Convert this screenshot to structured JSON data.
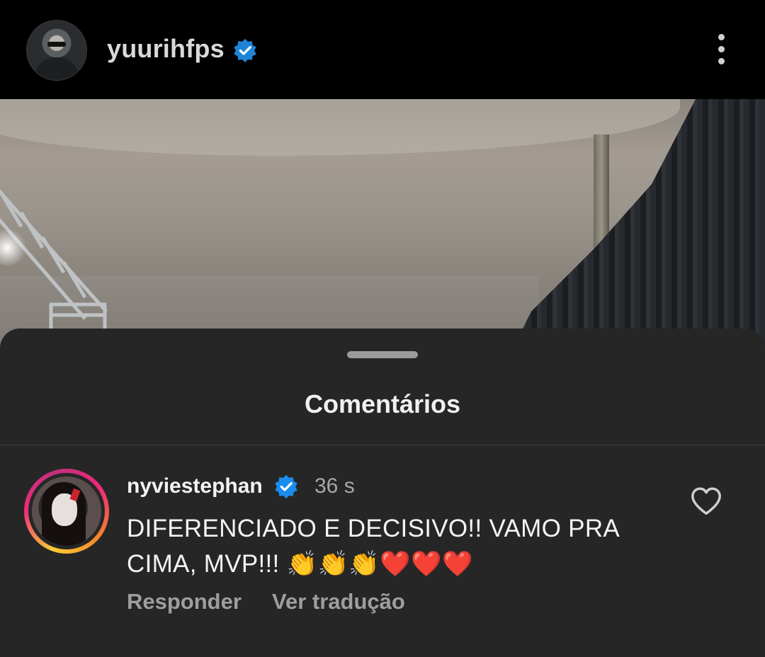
{
  "header": {
    "username": "yuurihfps",
    "verified_icon": "verified-badge-icon",
    "more_icon": "more-vertical-icon"
  },
  "sheet": {
    "title": "Comentários"
  },
  "comment": {
    "username": "nyviestephan",
    "time": "36 s",
    "text": "DIFERENCIADO E DECISIVO!! VAMO PRA CIMA, MVP!!! 👏👏👏❤️❤️❤️",
    "reply_label": "Responder",
    "translate_label": "Ver tradução",
    "like_icon": "heart-outline-icon"
  },
  "colors": {
    "background": "#000000",
    "sheet": "#262626",
    "verified_blue": "#0095f6",
    "muted_text": "#9e9e9e"
  }
}
